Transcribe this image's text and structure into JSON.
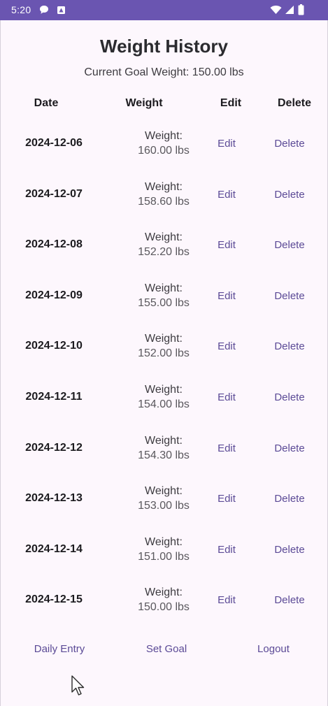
{
  "status_bar": {
    "time": "5:20",
    "bg_color": "#6a55b1",
    "icons_left": [
      "chat-bubble-icon",
      "app-notification-icon"
    ],
    "icons_right": [
      "wifi-icon",
      "cellular-signal-icon",
      "battery-icon"
    ]
  },
  "page": {
    "title": "Weight History",
    "goal_text": "Current Goal Weight: 150.00 lbs"
  },
  "table": {
    "headers": {
      "date": "Date",
      "weight": "Weight",
      "edit": "Edit",
      "delete": "Delete"
    },
    "rows": [
      {
        "date": "2024-12-06",
        "weight_label": "Weight:",
        "weight_value": "160.00 lbs",
        "edit": "Edit",
        "delete": "Delete"
      },
      {
        "date": "2024-12-07",
        "weight_label": "Weight:",
        "weight_value": "158.60 lbs",
        "edit": "Edit",
        "delete": "Delete"
      },
      {
        "date": "2024-12-08",
        "weight_label": "Weight:",
        "weight_value": "152.20 lbs",
        "edit": "Edit",
        "delete": "Delete"
      },
      {
        "date": "2024-12-09",
        "weight_label": "Weight:",
        "weight_value": "155.00 lbs",
        "edit": "Edit",
        "delete": "Delete"
      },
      {
        "date": "2024-12-10",
        "weight_label": "Weight:",
        "weight_value": "152.00 lbs",
        "edit": "Edit",
        "delete": "Delete"
      },
      {
        "date": "2024-12-11",
        "weight_label": "Weight:",
        "weight_value": "154.00 lbs",
        "edit": "Edit",
        "delete": "Delete"
      },
      {
        "date": "2024-12-12",
        "weight_label": "Weight:",
        "weight_value": "154.30 lbs",
        "edit": "Edit",
        "delete": "Delete"
      },
      {
        "date": "2024-12-13",
        "weight_label": "Weight:",
        "weight_value": "153.00 lbs",
        "edit": "Edit",
        "delete": "Delete"
      },
      {
        "date": "2024-12-14",
        "weight_label": "Weight:",
        "weight_value": "151.00 lbs",
        "edit": "Edit",
        "delete": "Delete"
      },
      {
        "date": "2024-12-15",
        "weight_label": "Weight:",
        "weight_value": "150.00 lbs",
        "edit": "Edit",
        "delete": "Delete"
      }
    ]
  },
  "bottom_nav": {
    "daily_entry": "Daily Entry",
    "set_goal": "Set Goal",
    "logout": "Logout"
  },
  "colors": {
    "accent": "#5b4a96",
    "background": "#fdf7fd",
    "text": "#1c1b1f"
  }
}
